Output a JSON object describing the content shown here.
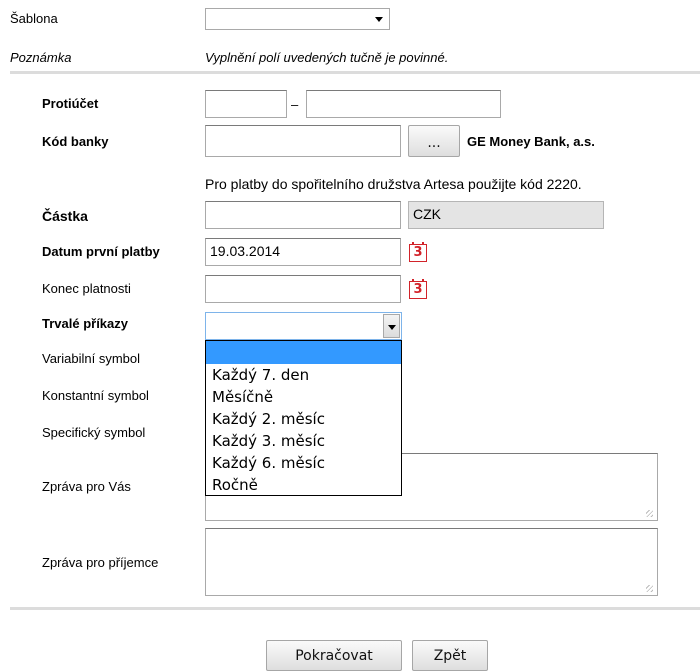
{
  "template": {
    "label": "Šablona",
    "value": ""
  },
  "note": {
    "label": "Poznámka",
    "text": "Vyplnění polí uvedených tučně je povinné."
  },
  "counter_account": {
    "label": "Protiúčet",
    "prefix": "",
    "separator": "–",
    "number": ""
  },
  "bank_code": {
    "label": "Kód banky",
    "value": "",
    "browse_label": "...",
    "bank_name": "GE Money Bank, a.s."
  },
  "artesa_hint": "Pro platby do spořitelního družstva Artesa použijte kód 2220.",
  "amount": {
    "label": "Částka",
    "value": "",
    "currency": "CZK"
  },
  "first_payment_date": {
    "label": "Datum první platby",
    "value": "19.03.2014",
    "calendar_icon": "calendar-icon"
  },
  "end_date": {
    "label": "Konec platnosti",
    "value": "",
    "calendar_icon": "calendar-icon"
  },
  "standing_orders": {
    "label": "Trvalé příkazy",
    "selected": "",
    "options": [
      "",
      "Každý 7. den",
      "Měsíčně",
      "Každý 2. měsíc",
      "Každý 3. měsíc",
      "Každý 6. měsíc",
      "Ročně"
    ]
  },
  "variable_symbol": {
    "label": "Variabilní symbol"
  },
  "constant_symbol": {
    "label": "Konstantní symbol"
  },
  "specific_symbol": {
    "label": "Specifický symbol"
  },
  "message_for_you": {
    "label": "Zpráva pro Vás",
    "value": ""
  },
  "message_for_recipient": {
    "label": "Zpráva pro příjemce",
    "value": ""
  },
  "buttons": {
    "continue": "Pokračovat",
    "back": "Zpět"
  },
  "colors": {
    "selection": "#3399ff",
    "calendar": "#d2232a",
    "divider": "#dcdcdc",
    "readonly": "#e4e4e4"
  }
}
